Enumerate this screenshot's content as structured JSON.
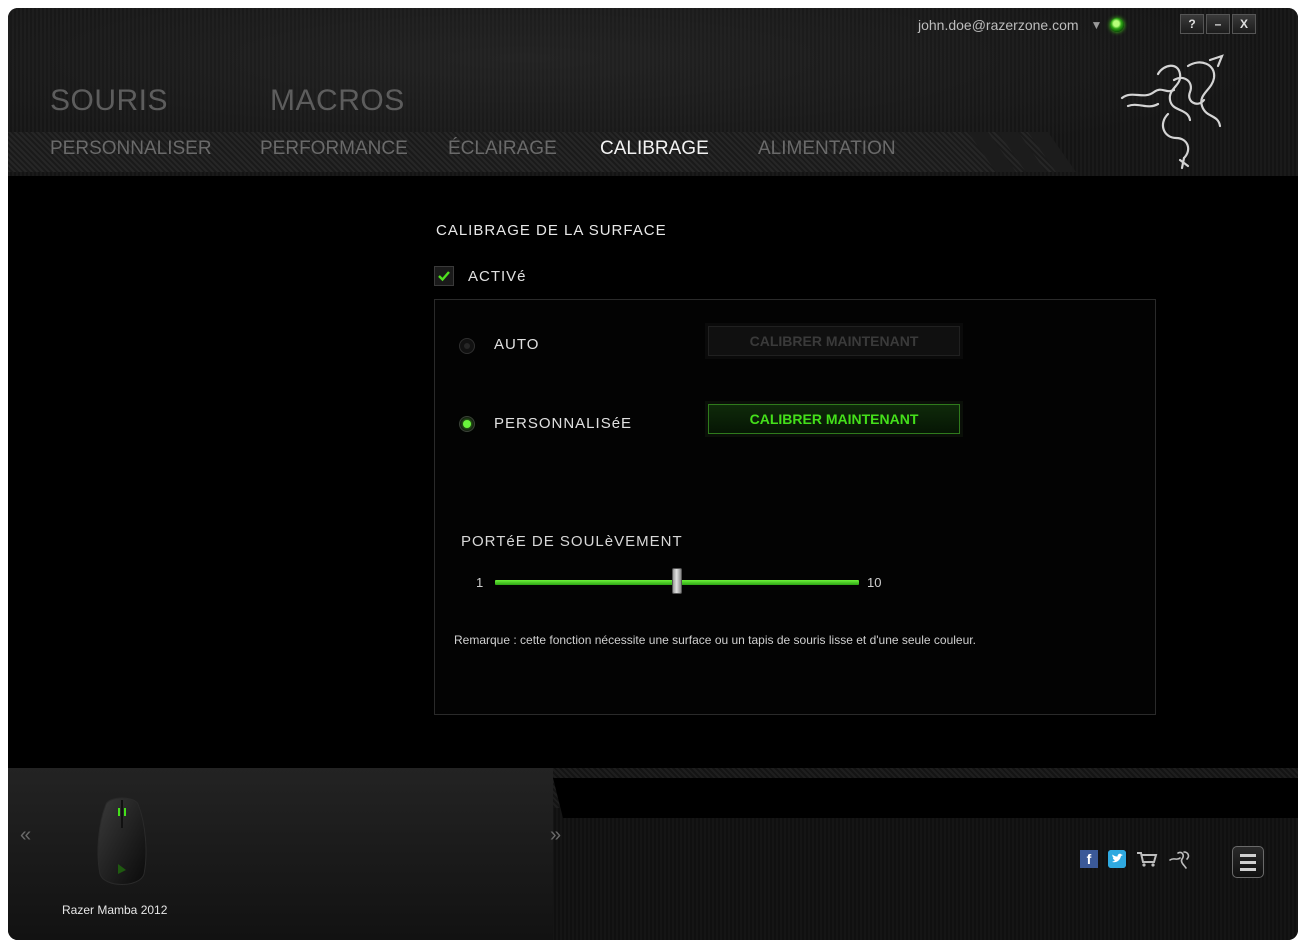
{
  "header": {
    "user_email": "john.doe@razerzone.com",
    "main_tabs": [
      "SOURIS",
      "MACROS"
    ],
    "sub_tabs": [
      "PERSONNALISER",
      "PERFORMANCE",
      "ÉCLAIRAGE",
      "CALIBRAGE",
      "ALIMENTATION"
    ],
    "active_sub_tab": "CALIBRAGE",
    "window_buttons": {
      "help": "?",
      "minimize": "–",
      "close": "X"
    },
    "status_color": "#44d11b"
  },
  "content": {
    "section_title": "CALIBRAGE DE LA SURFACE",
    "enabled_label": "ACTIVé",
    "enabled_checked": true,
    "options": {
      "auto_label": "AUTO",
      "auto_button": "CALIBRER MAINTENANT",
      "custom_label": "PERSONNALISéE",
      "custom_button": "CALIBRER MAINTENANT",
      "selected": "custom"
    },
    "lift_range": {
      "title": "PORTéE DE SOULèVEMENT",
      "min_label": "1",
      "max_label": "10",
      "min": 1,
      "max": 10,
      "value": 5.5
    },
    "note": "Remarque : cette fonction nécessite une surface ou un tapis de souris lisse et d'une seule couleur."
  },
  "footer": {
    "device_name": "Razer Mamba 2012",
    "prev_icon": "«",
    "next_icon": "»",
    "social_icons": [
      "facebook-icon",
      "twitter-icon",
      "cart-icon",
      "razer-icon"
    ],
    "accent_color": "#44e01a"
  }
}
